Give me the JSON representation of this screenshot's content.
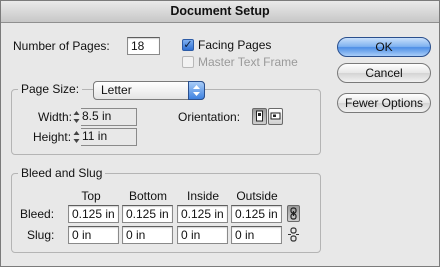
{
  "window": {
    "title": "Document Setup"
  },
  "pages": {
    "number_label": "Number of Pages:",
    "number_value": "18",
    "facing_label": "Facing Pages",
    "facing_checked": true,
    "master_label": "Master Text Frame",
    "master_checked": false
  },
  "buttons": {
    "ok": "OK",
    "cancel": "Cancel",
    "fewer": "Fewer Options"
  },
  "page_size": {
    "group_label": "Page Size:",
    "selected": "Letter",
    "width_label": "Width:",
    "width_value": "8.5 in",
    "height_label": "Height:",
    "height_value": "11 in",
    "orientation_label": "Orientation:",
    "orientation_selected": "portrait"
  },
  "bleed_slug": {
    "group_label": "Bleed and Slug",
    "columns": [
      "Top",
      "Bottom",
      "Inside",
      "Outside"
    ],
    "bleed_label": "Bleed:",
    "bleed_values": [
      "0.125 in",
      "0.125 in",
      "0.125 in",
      "0.125 in"
    ],
    "slug_label": "Slug:",
    "slug_values": [
      "0 in",
      "0 in",
      "0 in",
      "0 in"
    ],
    "bleed_linked": true,
    "slug_linked": false
  },
  "colors": {
    "accent": "#3f82e0",
    "window_bg": "#e8e8e8"
  }
}
